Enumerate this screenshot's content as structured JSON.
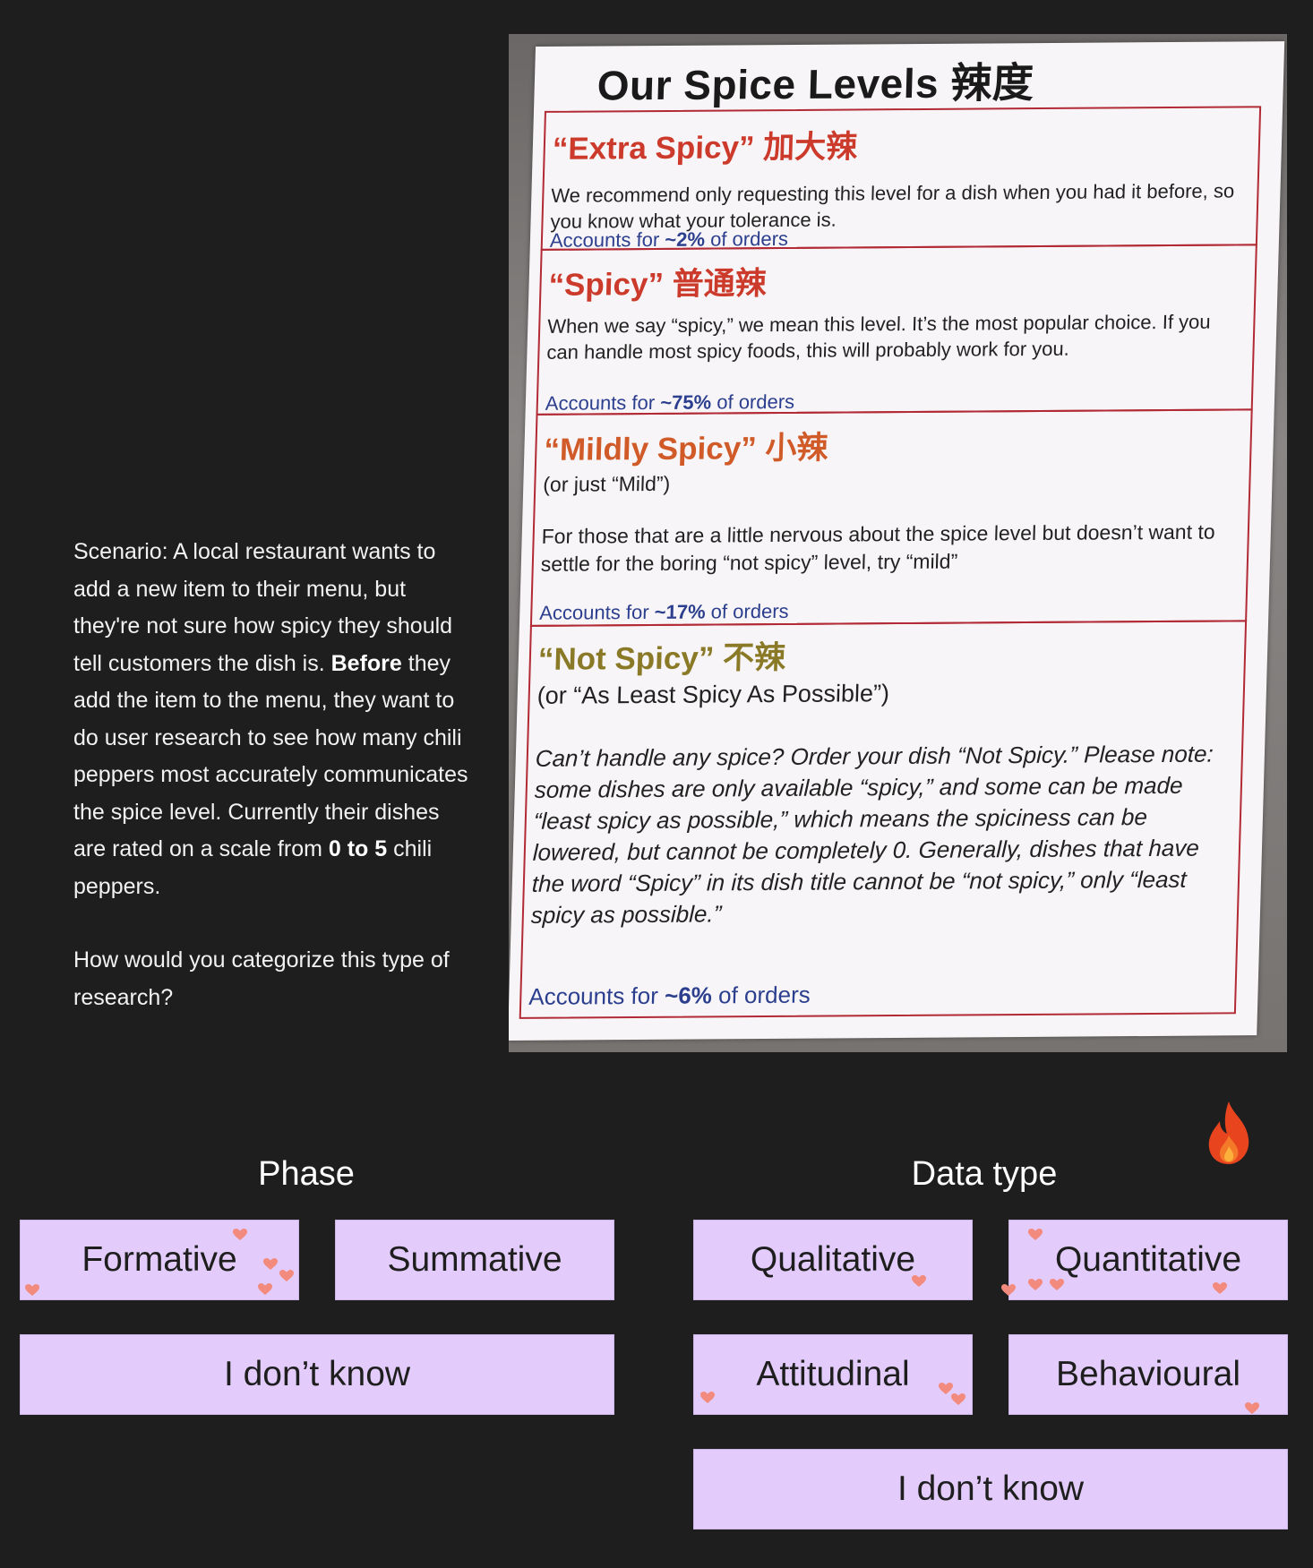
{
  "scenario": {
    "line1": "Scenario: A local restaurant wants to add a new item to their menu, but they're not sure how spicy they should tell customers the dish is.",
    "before_bold": "Before",
    "line2": " they add the item to the menu, they want to do user research to see how many chili peppers most accurately communicates the spice level. Currently their dishes are rated on a scale from ",
    "scale_bold": "0 to 5",
    "line3": " chili peppers.",
    "question": "How would you categorize this type of research?"
  },
  "menu_photo": {
    "title": "Our Spice Levels 辣度",
    "levels": [
      {
        "title": "“Extra Spicy” 加大辣",
        "sub": "",
        "desc": "We recommend only requesting this level for a dish when you had it before, so you know what your tolerance is.",
        "acc_prefix": "Accounts for ",
        "acc_value": "~2%",
        "acc_suffix": " of orders"
      },
      {
        "title": "“Spicy” 普通辣",
        "sub": "",
        "desc": "When we say “spicy,” we mean this level. It’s the most popular choice. If you can handle most spicy foods, this will probably work for you.",
        "acc_prefix": "Accounts for ",
        "acc_value": "~75%",
        "acc_suffix": " of orders"
      },
      {
        "title": "“Mildly Spicy” 小辣",
        "sub": "(or just “Mild”)",
        "desc": "For those that are a little nervous about the spice level but doesn’t want to settle for the boring “not spicy” level, try “mild”",
        "acc_prefix": "Accounts for ",
        "acc_value": "~17%",
        "acc_suffix": " of orders"
      },
      {
        "title": "“Not Spicy” 不辣",
        "sub": "(or “As Least Spicy As Possible”)",
        "desc": "Can’t handle any spice? Order your dish “Not Spicy.” Please note: some dishes are only available “spicy,” and some can be made “least spicy as possible,” which means the spiciness can be lowered, but cannot be completely 0. Generally, dishes that have the word “Spicy” in its dish title cannot be “not spicy,” only “least spicy as possible.”",
        "acc_prefix": "Accounts for ",
        "acc_value": "~6%",
        "acc_suffix": " of orders"
      }
    ]
  },
  "phase": {
    "title": "Phase",
    "formative": "Formative",
    "summative": "Summative",
    "dont_know": "I don’t know"
  },
  "data_type": {
    "title": "Data type",
    "qualitative": "Qualitative",
    "quantitative": "Quantitative",
    "attitudinal": "Attitudinal",
    "behavioural": "Behavioural",
    "dont_know": "I don’t know"
  },
  "colors": {
    "background": "#1e1e1e",
    "option_fill": "#e3ccfb",
    "heart": "#f28b7d",
    "fire": "#e8451f"
  },
  "icons": [
    "heart-icon",
    "fire-icon"
  ]
}
